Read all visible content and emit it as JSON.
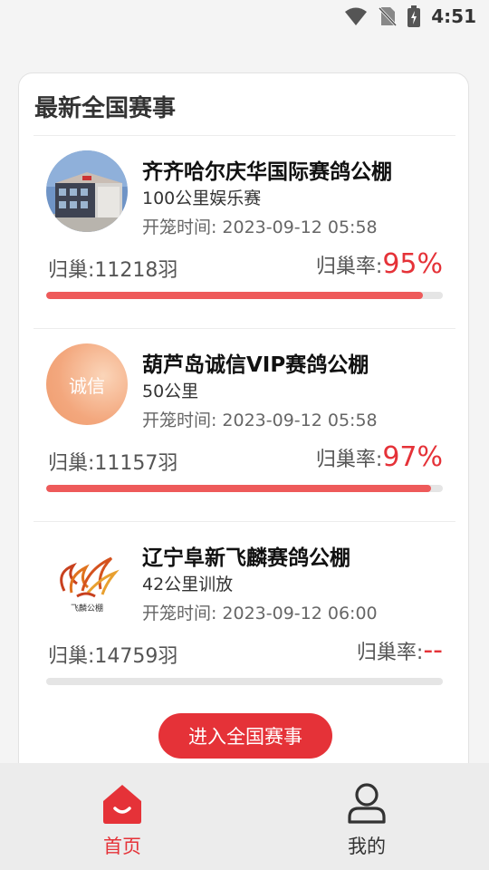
{
  "status_bar": {
    "time": "4:51",
    "icons": [
      "wifi-icon",
      "no-sim-icon",
      "battery-charging-icon"
    ]
  },
  "section": {
    "title": "最新全国赛事"
  },
  "races": [
    {
      "name": "齐齐哈尔庆华国际赛鸽公棚",
      "distance": "100公里娱乐赛",
      "time_label": "开笼时间:",
      "time_value": "2023-09-12 05:58",
      "count_label": "归巢:",
      "count_value": "11218羽",
      "rate_label": "归巢率:",
      "rate_value": "95%",
      "progress": 0.95,
      "avatar": "building-photo"
    },
    {
      "name": "葫芦岛诚信VIP赛鸽公棚",
      "distance": "50公里",
      "time_label": "开笼时间:",
      "time_value": "2023-09-12 05:58",
      "count_label": "归巢:",
      "count_value": "11157羽",
      "rate_label": "归巢率:",
      "rate_value": "97%",
      "progress": 0.97,
      "avatar": "诚信"
    },
    {
      "name": "辽宁阜新飞麟赛鸽公棚",
      "distance": "42公里训放",
      "time_label": "开笼时间:",
      "time_value": "2023-09-12 06:00",
      "count_label": "归巢:",
      "count_value": "14759羽",
      "rate_label": "归巢率:",
      "rate_value": "--",
      "progress": 0,
      "avatar": "飞麟公棚"
    }
  ],
  "enter_button": {
    "label": "进入全国赛事"
  },
  "tabbar": {
    "items": [
      {
        "label": "首页",
        "icon": "home-icon",
        "active": true
      },
      {
        "label": "我的",
        "icon": "user-icon",
        "active": false
      }
    ]
  },
  "colors": {
    "accent": "#e53238",
    "progress": "#ee5a5a",
    "track": "#e5e5e5"
  }
}
